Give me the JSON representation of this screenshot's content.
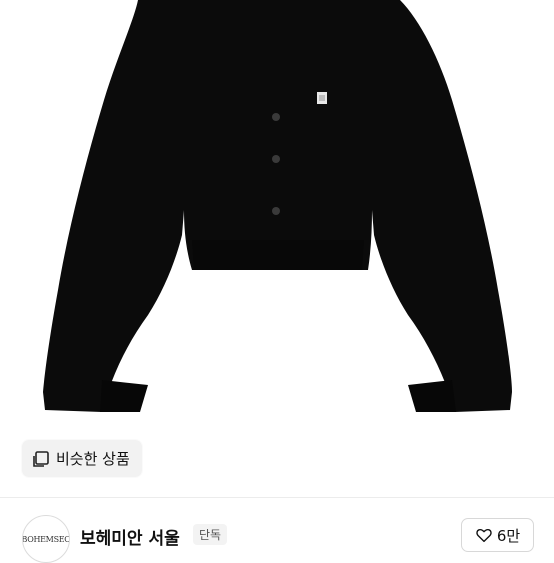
{
  "product": {
    "image_alt": "black cardigan",
    "similar_button_label": "비슷한 상품",
    "similar_icon": "copy-icon"
  },
  "shop": {
    "logo_text": "BOHEMSEO",
    "name": "보헤미안 서울",
    "badge": "단독"
  },
  "like": {
    "icon": "heart-outline-icon",
    "count": "6만"
  },
  "colors": {
    "garment": "#0b0b0b",
    "button_bg": "#f2f2f2",
    "border": "#d8d8d8"
  }
}
